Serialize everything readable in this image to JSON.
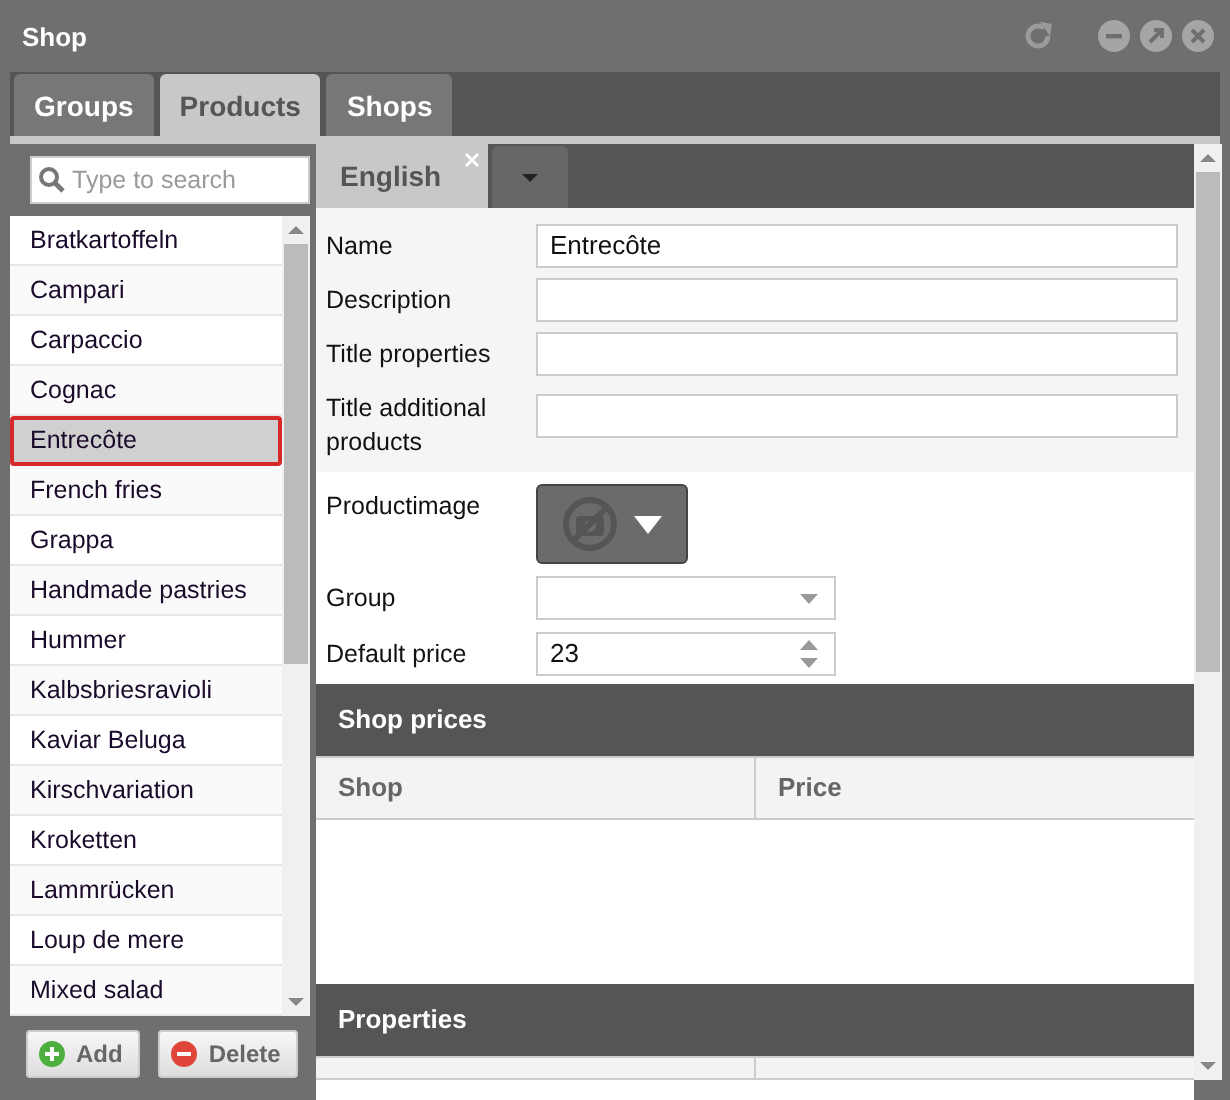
{
  "window": {
    "title": "Shop"
  },
  "tabs": [
    {
      "label": "Groups",
      "selected": false
    },
    {
      "label": "Products",
      "selected": true
    },
    {
      "label": "Shops",
      "selected": false
    }
  ],
  "search": {
    "placeholder": "Type to search"
  },
  "products": [
    {
      "name": "Bratkartoffeln",
      "selected": false
    },
    {
      "name": "Campari",
      "selected": false
    },
    {
      "name": "Carpaccio",
      "selected": false
    },
    {
      "name": "Cognac",
      "selected": false
    },
    {
      "name": "Entrecôte",
      "selected": true
    },
    {
      "name": "French fries",
      "selected": false
    },
    {
      "name": "Grappa",
      "selected": false
    },
    {
      "name": "Handmade pastries",
      "selected": false
    },
    {
      "name": "Hummer",
      "selected": false
    },
    {
      "name": "Kalbsbriesravioli",
      "selected": false
    },
    {
      "name": "Kaviar Beluga",
      "selected": false
    },
    {
      "name": "Kirschvariation",
      "selected": false
    },
    {
      "name": "Kroketten",
      "selected": false
    },
    {
      "name": "Lammrücken",
      "selected": false
    },
    {
      "name": "Loup de mere",
      "selected": false
    },
    {
      "name": "Mixed salad",
      "selected": false
    }
  ],
  "list_buttons": [
    {
      "label": "Add",
      "kind": "add"
    },
    {
      "label": "Delete",
      "kind": "delete"
    }
  ],
  "language_tabs": [
    {
      "label": "English",
      "selected": true
    }
  ],
  "translated_fields": [
    {
      "label": "Name",
      "value": "Entrecôte"
    },
    {
      "label": "Description"
    },
    {
      "label": "Title properties"
    },
    {
      "label": "Title additional products"
    }
  ],
  "fields": [
    {
      "label": "Productimage",
      "kind": "image"
    },
    {
      "label": "Group",
      "kind": "select"
    },
    {
      "label": "Default price",
      "kind": "number",
      "value": "23"
    }
  ],
  "shop_prices": {
    "title": "Shop prices",
    "columns": [
      "Shop",
      "Price"
    ]
  },
  "properties": {
    "title": "Properties"
  }
}
